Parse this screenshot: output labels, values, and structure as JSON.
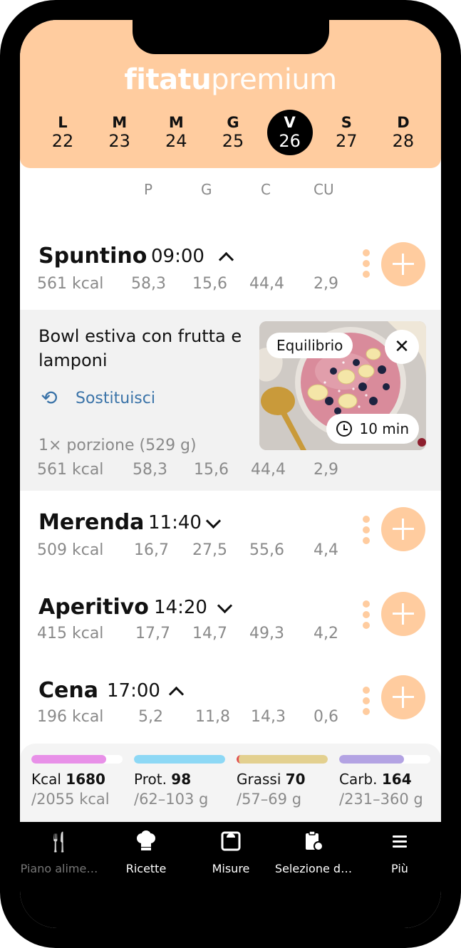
{
  "header": {
    "logo_brand": "fitatu",
    "logo_tier": "premium",
    "days": [
      {
        "letter": "L",
        "num": "22"
      },
      {
        "letter": "M",
        "num": "23"
      },
      {
        "letter": "M",
        "num": "24"
      },
      {
        "letter": "G",
        "num": "25"
      },
      {
        "letter": "V",
        "num": "26",
        "selected": true
      },
      {
        "letter": "S",
        "num": "27"
      },
      {
        "letter": "D",
        "num": "28"
      }
    ]
  },
  "macro_headers": [
    "P",
    "G",
    "C",
    "CU"
  ],
  "meals": [
    {
      "name": "Spuntino",
      "time": "09:00",
      "expanded": true,
      "kcal": "561 kcal",
      "p": "58,3",
      "g": "15,6",
      "c": "44,4",
      "cu": "2,9"
    },
    {
      "name": "Merenda",
      "time": "11:40",
      "expanded": false,
      "kcal": "509 kcal",
      "p": "16,7",
      "g": "27,5",
      "c": "55,6",
      "cu": "4,4"
    },
    {
      "name": "Aperitivo",
      "time": "14:20",
      "expanded": false,
      "kcal": "415 kcal",
      "p": "17,7",
      "g": "14,7",
      "c": "49,3",
      "cu": "4,2"
    },
    {
      "name": "Cena",
      "time": "17:00",
      "expanded": true,
      "kcal": "196 kcal",
      "p": "5,2",
      "g": "11,8",
      "c": "14,3",
      "cu": "0,6"
    }
  ],
  "recipe": {
    "name": "Bowl estiva con frutta e lamponi",
    "swap_label": "Sostituisci",
    "tag": "Equilibrio",
    "time": "10 min",
    "portion": "1× porzione (529 g)",
    "kcal": "561 kcal",
    "p": "58,3",
    "g": "15,6",
    "c": "44,4",
    "cu": "2,9"
  },
  "summary": [
    {
      "label": "Kcal",
      "value": "1680",
      "range": "/2055 kcal",
      "fill": 0.82,
      "color": "#e890e8"
    },
    {
      "label": "Prot.",
      "value": "98",
      "range": "/62–103 g",
      "fill": 1.0,
      "color": "#8dd8f5"
    },
    {
      "label": "Grassi",
      "value": "70",
      "range": "/57–69 g",
      "fill": 1.0,
      "color": "#e3d08f"
    },
    {
      "label": "Carb.",
      "value": "164",
      "range": "/231–360 g",
      "fill": 0.71,
      "color": "#b3a3e3"
    }
  ],
  "nav": [
    {
      "label": "Piano alime…",
      "icon": "fork-knife-icon",
      "active": false
    },
    {
      "label": "Ricette",
      "icon": "chef-hat-icon",
      "active": true
    },
    {
      "label": "Misure",
      "icon": "scale-icon",
      "active": true
    },
    {
      "label": "Selezione d…",
      "icon": "clipboard-apple-icon",
      "active": true
    },
    {
      "label": "Più",
      "icon": "menu-icon",
      "active": true
    }
  ],
  "colors": {
    "accent": "#ffcc9f",
    "link": "#3a73a8",
    "nav_bg": "#000000"
  }
}
